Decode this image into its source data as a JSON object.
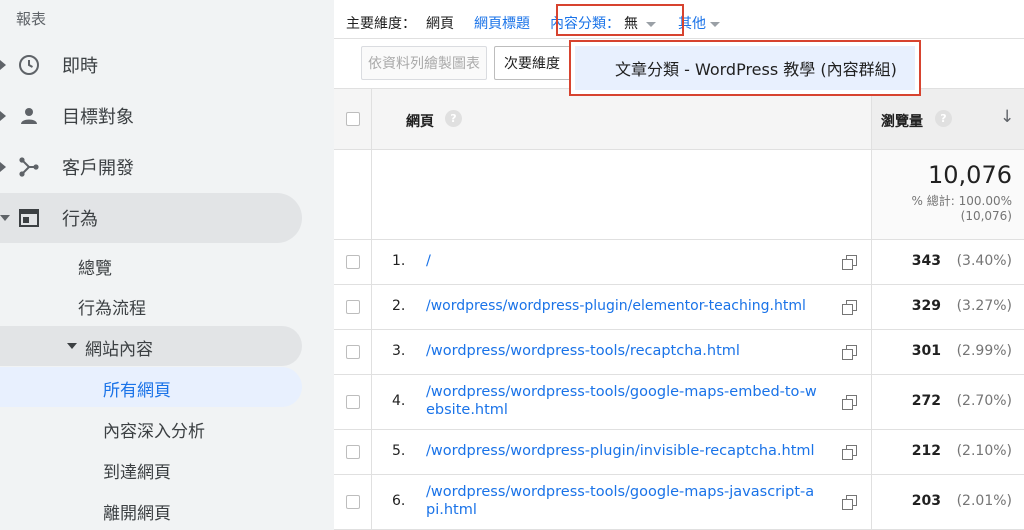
{
  "sidebar": {
    "header": "報表",
    "items": [
      {
        "label": "即時",
        "icon": "clock-icon"
      },
      {
        "label": "目標對象",
        "icon": "person-icon"
      },
      {
        "label": "客戶開發",
        "icon": "acquisition-icon"
      },
      {
        "label": "行為",
        "icon": "behavior-icon"
      }
    ],
    "behavior_sub": [
      "總覽",
      "行為流程"
    ],
    "site_content": "網站內容",
    "site_content_sub": [
      "所有網頁",
      "內容深入分析",
      "到達網頁",
      "離開網頁"
    ]
  },
  "dimensions": {
    "label": "主要維度：",
    "current": "網頁",
    "page_title": "網頁標題",
    "content_group_label": "內容分類：",
    "content_group_value": "無",
    "other": "其他"
  },
  "toolbar": {
    "plot_rows": "依資料列繪製圖表",
    "secondary_dimension": "次要維度"
  },
  "dropdown": {
    "option": "文章分類 - WordPress 教學 (內容群組)"
  },
  "table": {
    "col_page": "網頁",
    "col_views": "瀏覽量",
    "total_value": "10,076",
    "total_pct_line1": "% 總計: 100.00%",
    "total_pct_line2": "(10,076)",
    "rows": [
      {
        "num": "1.",
        "page": "/",
        "views": "343",
        "pct": "(3.40%)"
      },
      {
        "num": "2.",
        "page": "/wordpress/wordpress-plugin/elementor-teaching.html",
        "views": "329",
        "pct": "(3.27%)"
      },
      {
        "num": "3.",
        "page": "/wordpress/wordpress-tools/recaptcha.html",
        "views": "301",
        "pct": "(2.99%)"
      },
      {
        "num": "4.",
        "page": "/wordpress/wordpress-tools/google-maps-embed-to-website.html",
        "views": "272",
        "pct": "(2.70%)"
      },
      {
        "num": "5.",
        "page": "/wordpress/wordpress-plugin/invisible-recaptcha.html",
        "views": "212",
        "pct": "(2.10%)"
      },
      {
        "num": "6.",
        "page": "/wordpress/wordpress-tools/google-maps-javascript-api.html",
        "views": "203",
        "pct": "(2.01%)"
      }
    ]
  }
}
